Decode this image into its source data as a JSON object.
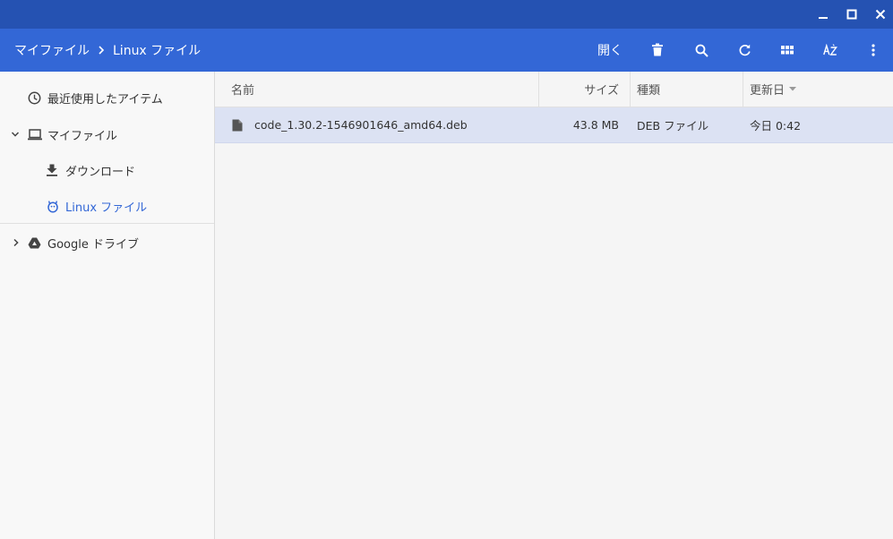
{
  "window": {
    "minimize_icon": "minimize-icon",
    "maximize_icon": "maximize-icon",
    "close_icon": "close-icon"
  },
  "breadcrumb": {
    "items": [
      "マイファイル",
      "Linux ファイル"
    ]
  },
  "toolbar": {
    "open_label": "開く",
    "icons": [
      "delete-icon",
      "search-icon",
      "refresh-icon",
      "grid-view-icon",
      "sort-az-icon",
      "more-vert-icon"
    ]
  },
  "sidebar": {
    "items": [
      {
        "label": "最近使用したアイテム",
        "icon": "clock-icon"
      },
      {
        "label": "マイファイル",
        "icon": "laptop-icon",
        "expanded": true
      },
      {
        "label": "ダウンロード",
        "icon": "download-icon"
      },
      {
        "label": "Linux ファイル",
        "icon": "penguin-icon",
        "active": true
      },
      {
        "label": "Google ドライブ",
        "icon": "drive-icon",
        "expanded": false
      }
    ]
  },
  "file_list": {
    "columns": [
      "名前",
      "サイズ",
      "種類",
      "更新日"
    ],
    "sort_column": "更新日",
    "rows": [
      {
        "name": "code_1.30.2-1546901646_amd64.deb",
        "size": "43.8 MB",
        "type": "DEB ファイル",
        "modified": "今日 0:42",
        "selected": true
      }
    ]
  },
  "colors": {
    "titlebar": "#2552b2",
    "toolbar": "#3367d6",
    "selection": "#dce2f3",
    "active_nav": "#3367d6"
  }
}
